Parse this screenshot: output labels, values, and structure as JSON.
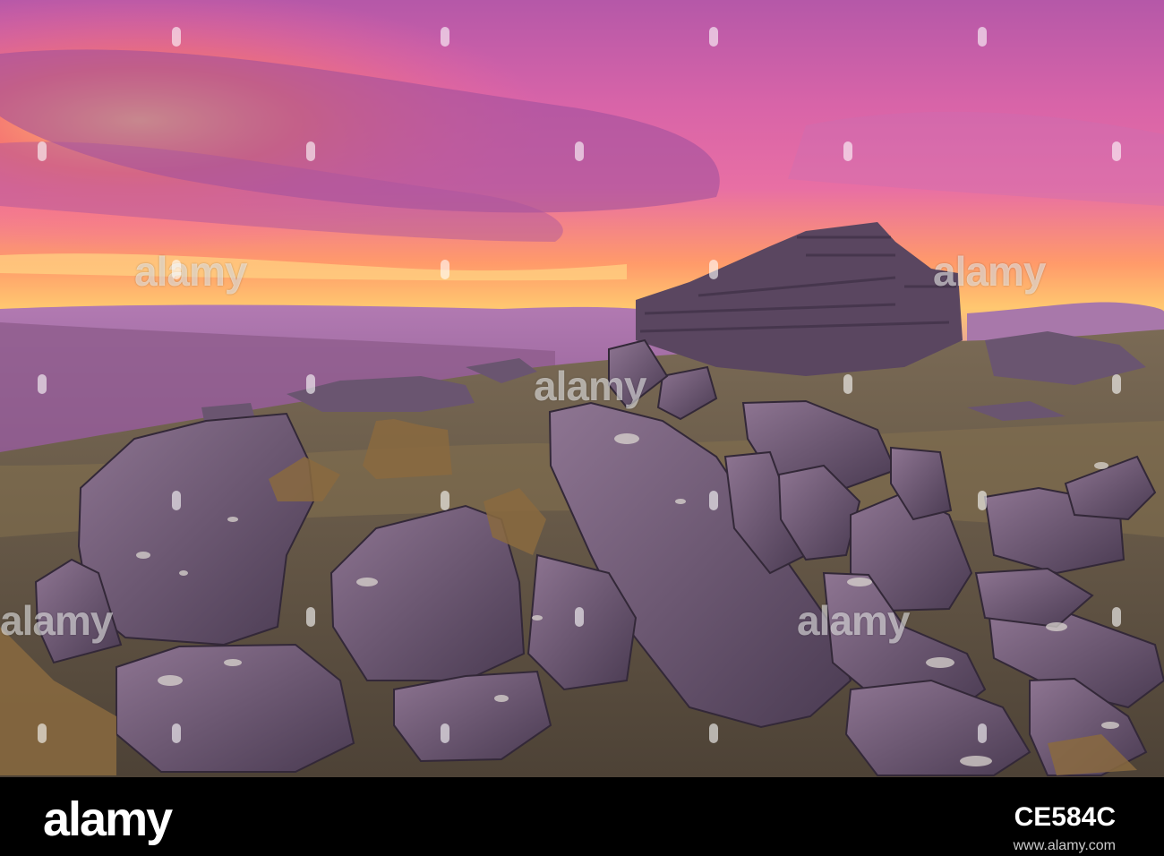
{
  "watermark": {
    "text": "alamy"
  },
  "footer": {
    "logo": "alamy",
    "image_id": "CE584C",
    "url": "www.alamy.com"
  },
  "colors": {
    "sky_top": "#c05aa8",
    "sky_glow": "#ff8a5a",
    "horizon_gold": "#ffd070",
    "rock": "#5e4a66",
    "grass": "#6b5a3a"
  }
}
